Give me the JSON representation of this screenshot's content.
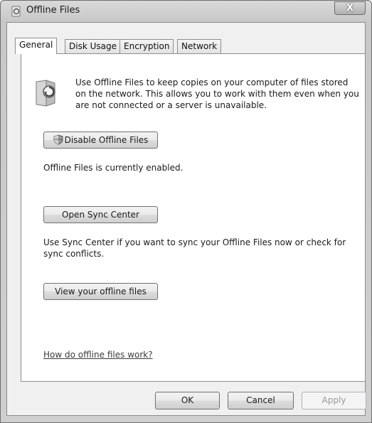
{
  "window": {
    "title": "Offline Files",
    "close_label": "X"
  },
  "tabs": [
    {
      "label": "General",
      "active": true
    },
    {
      "label": "Disk Usage",
      "active": false
    },
    {
      "label": "Encryption",
      "active": false
    },
    {
      "label": "Network",
      "active": false
    }
  ],
  "general": {
    "description": "Use Offline Files to keep copies on your computer of files stored on the network.  This allows you to work with them even when you are not connected or a server is unavailable.",
    "disable_button": "Disable Offline Files",
    "status_text": "Offline Files is currently enabled.",
    "sync_button": "Open Sync Center",
    "sync_text": "Use Sync Center if you want to sync your Offline Files now or check for sync conflicts.",
    "view_button": "View your offline files",
    "help_link": "How do offline files work?"
  },
  "footer": {
    "ok": "OK",
    "cancel": "Cancel",
    "apply": "Apply"
  },
  "icons": {
    "title": "offline-files-icon",
    "info": "offline-files-large-icon",
    "shield": "uac-shield-icon"
  }
}
